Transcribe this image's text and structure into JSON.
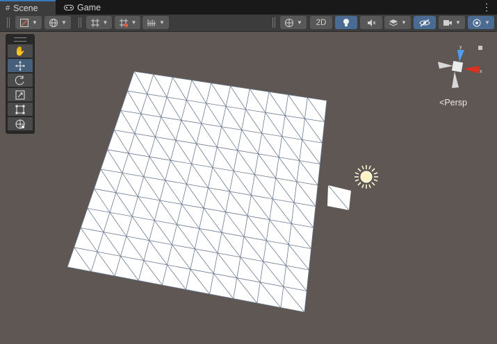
{
  "tabs": [
    {
      "label": "Scene",
      "icon": "hash-icon",
      "active": true
    },
    {
      "label": "Game",
      "icon": "gamepad-icon",
      "active": false
    }
  ],
  "toolbar": {
    "mode_2d_label": "2D",
    "accent": "#4a6c93"
  },
  "tools": [
    "hand-tool",
    "move-tool",
    "rotate-tool",
    "scale-tool",
    "rect-tool",
    "transform-tool"
  ],
  "gizmo": {
    "projection_label": "Persp",
    "axis_y": "y",
    "axis_x": "x"
  },
  "colors": {
    "viewport_bg": "#5e5753",
    "axis_x": "#d9321f",
    "axis_y": "#4f9cf0",
    "active_tab": "#3a79bb"
  }
}
